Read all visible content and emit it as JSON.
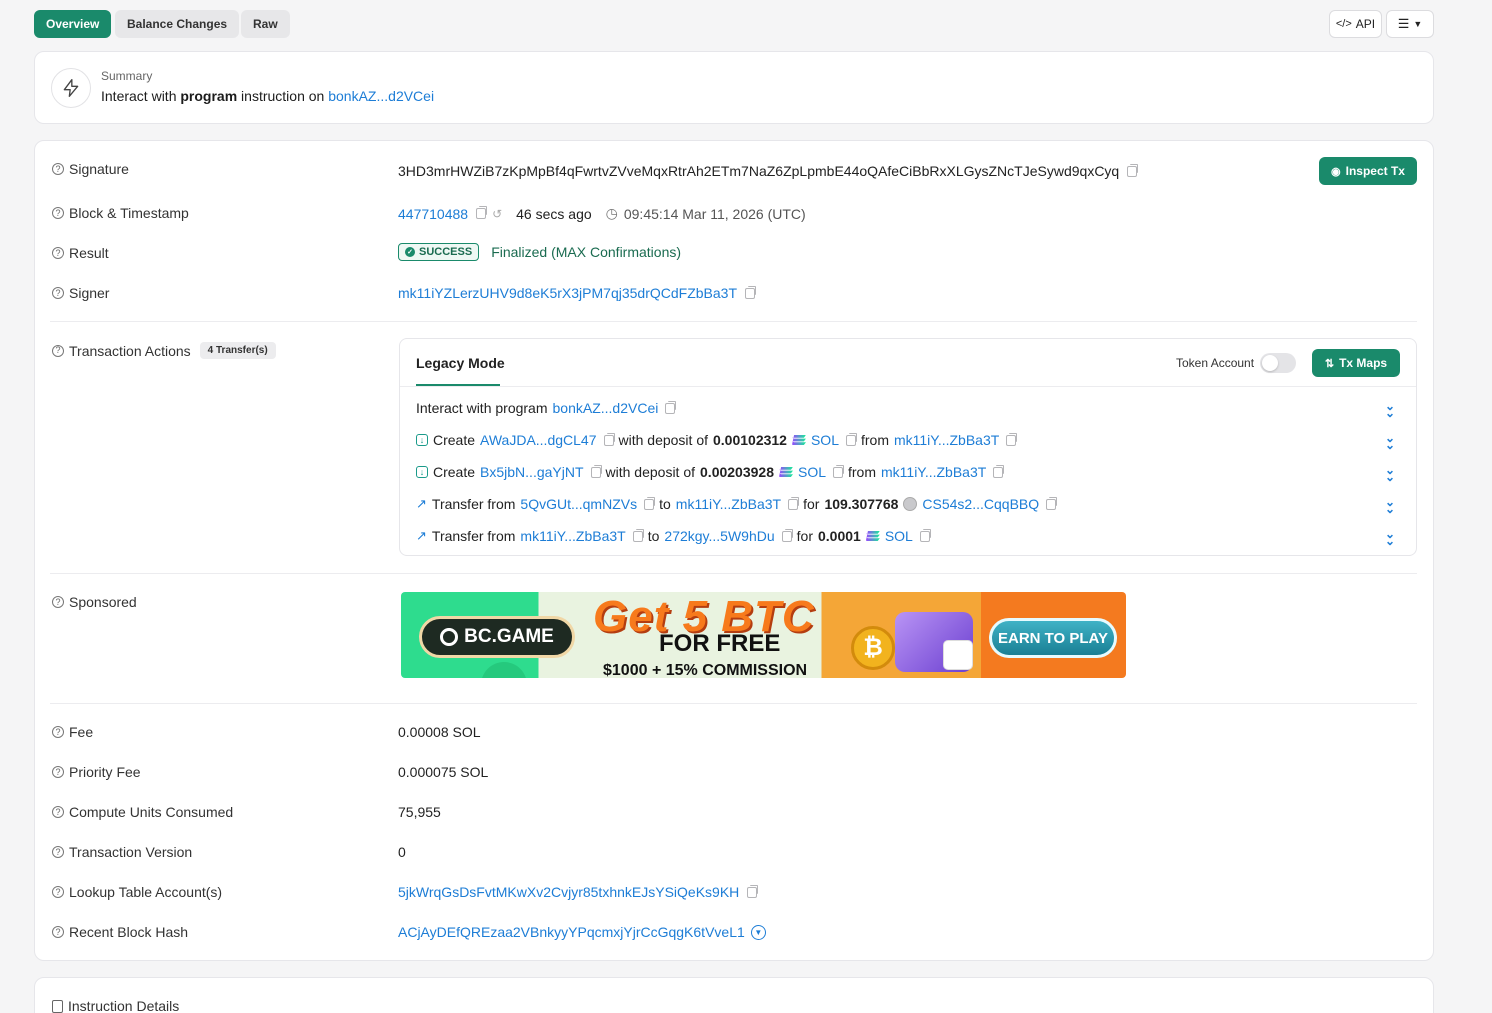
{
  "tabs": [
    {
      "label": "Overview"
    },
    {
      "label": "Balance Changes"
    },
    {
      "label": "Raw"
    }
  ],
  "toolbar": {
    "api_label": "API"
  },
  "summary": {
    "heading": "Summary",
    "pre": "Interact with ",
    "bold": "program",
    "mid": " instruction on ",
    "program_link": "bonkAZ...d2VCei"
  },
  "details": {
    "signature_label": "Signature",
    "signature": "3HD3mrHWZiB7zKpMpBf4qFwrtvZVveMqxRtrAh2ETm7NaZ6ZpLpmbE44oQAfeCiBbRxXLGysZNcTJeSywd9qxCyq",
    "inspect_label": "Inspect Tx",
    "block_label": "Block & Timestamp",
    "block": "447710488",
    "age": "46 secs ago",
    "timestamp": "09:45:14 Mar 11, 2026 (UTC)",
    "result_label": "Result",
    "result_badge": "SUCCESS",
    "result_text": "Finalized (MAX Confirmations)",
    "signer_label": "Signer",
    "signer": "mk11iYZLerzUHV9d8eK5rX3jPM7qj35drQCdFZbBa3T"
  },
  "actions": {
    "label": "Transaction Actions",
    "count": "4 Transfer(s)",
    "mode_tab": "Legacy Mode",
    "token_account_label": "Token Account",
    "tx_maps_label": "Tx Maps",
    "rows": [
      {
        "a": "Interact with program",
        "b": "bonkAZ...d2VCei"
      },
      {
        "a": "Create",
        "b": "AWaJDA...dgCL47",
        "c": "with deposit of",
        "amount": "0.00102312",
        "token": "SOL",
        "d": "from",
        "e": "mk11iY...ZbBa3T"
      },
      {
        "a": "Create",
        "b": "Bx5jbN...gaYjNT",
        "c": "with deposit of",
        "amount": "0.00203928",
        "token": "SOL",
        "d": "from",
        "e": "mk11iY...ZbBa3T"
      },
      {
        "a": "Transfer from",
        "b": "5QvGUt...qmNZVs",
        "c": "to",
        "d": "mk11iY...ZbBa3T",
        "e": "for",
        "amount": "109.307768",
        "token": "CS54s2...CqqBBQ"
      },
      {
        "a": "Transfer from",
        "b": "mk11iY...ZbBa3T",
        "c": "to",
        "d": "272kgy...5W9hDu",
        "e": "for",
        "amount": "0.0001",
        "token": "SOL"
      }
    ]
  },
  "sponsored": {
    "label": "Sponsored",
    "brand": "BC.GAME",
    "headline": "Get 5 BTC",
    "subheadline": "FOR FREE",
    "offer": "$1000 + 15% COMMISSION",
    "cta": "EARN TO PLAY"
  },
  "fees": {
    "fee_label": "Fee",
    "fee": "0.00008 SOL",
    "priority_label": "Priority Fee",
    "priority": "0.000075 SOL",
    "cu_label": "Compute Units Consumed",
    "cu": "75,955",
    "version_label": "Transaction Version",
    "version": "0",
    "lookup_label": "Lookup Table Account(s)",
    "lookup": "5jkWrqGsDsFvtMKwXv2Cvjyr85txhnkEJsYSiQeKs9KH",
    "blockhash_label": "Recent Block Hash",
    "blockhash": "ACjAyDEfQREzaa2VBnkyyYPqcmxjYjrCcGqgK6tVveL1"
  },
  "instruction": {
    "label": "Instruction Details"
  },
  "colors": {
    "accent": "#1a8a6b",
    "link": "#1d7dd6"
  }
}
